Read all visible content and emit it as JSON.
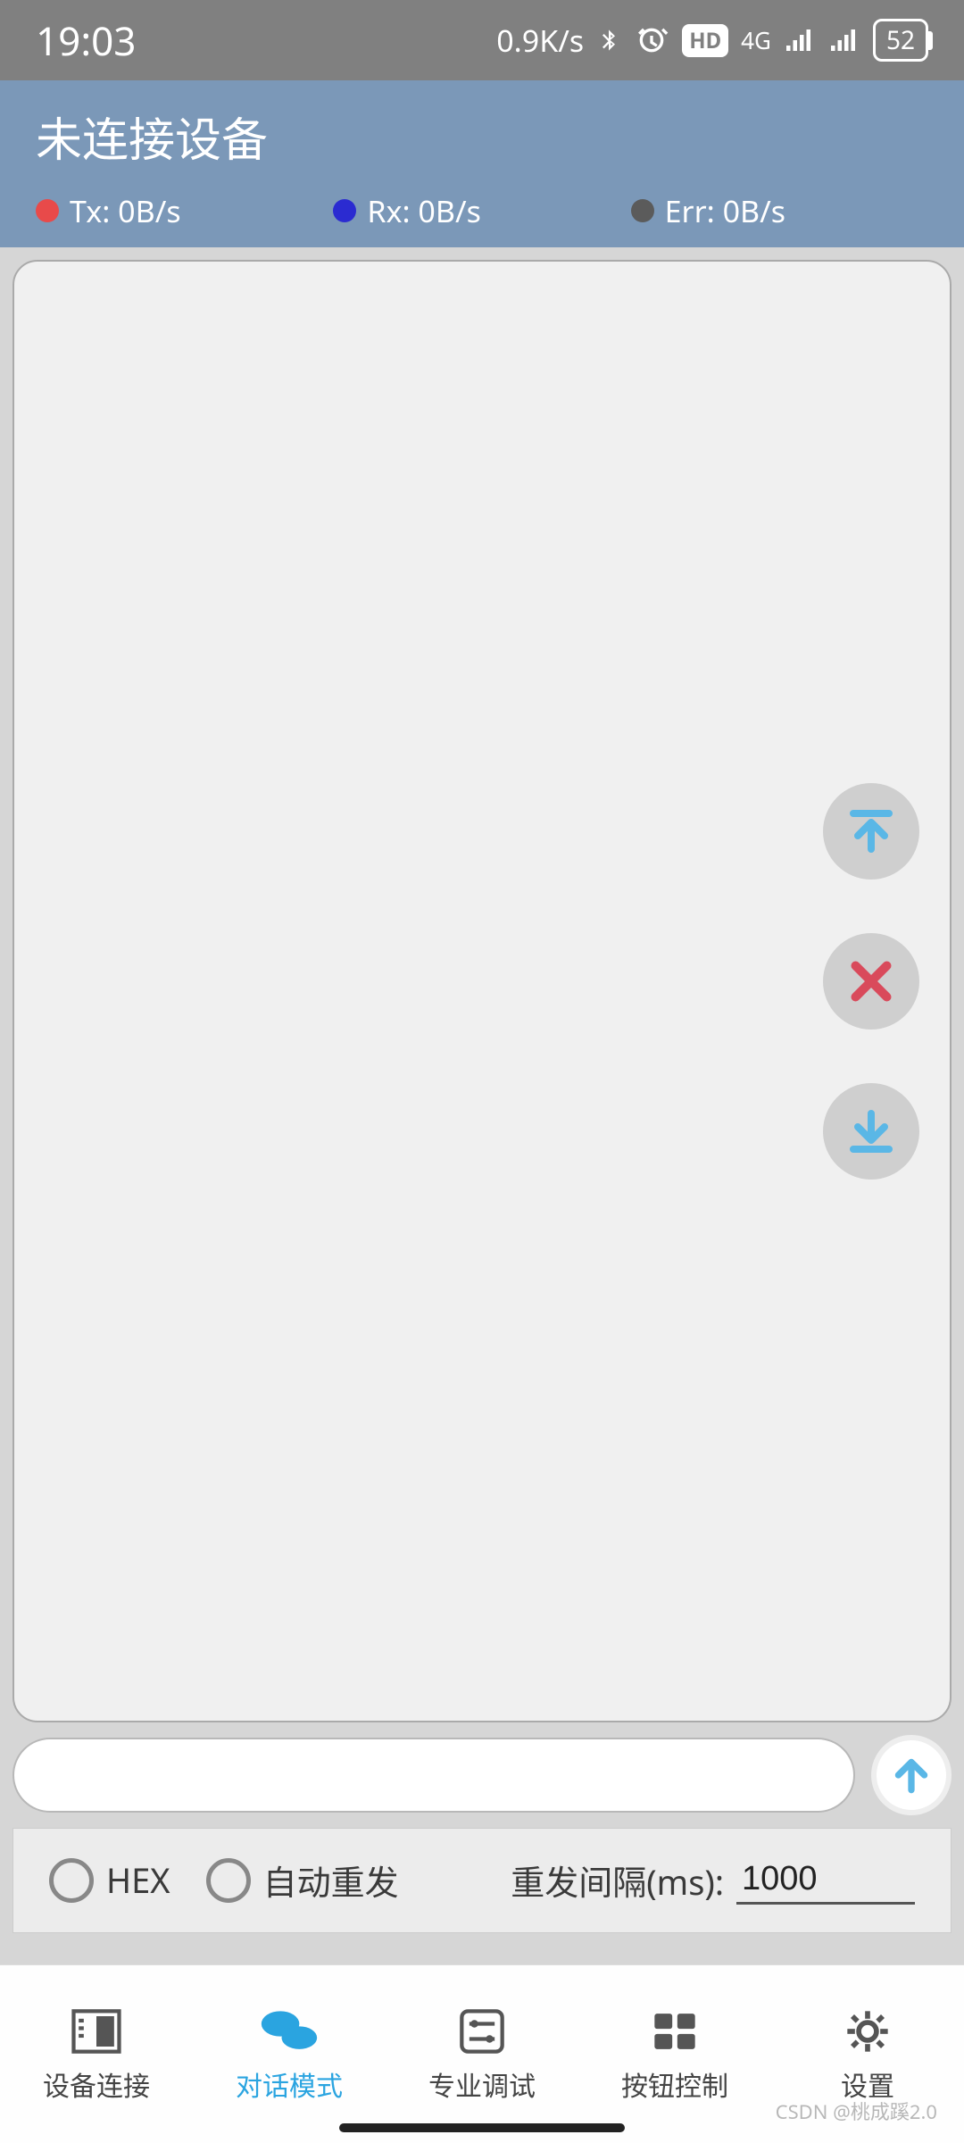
{
  "status": {
    "time": "19:03",
    "net_speed": "0.9K/s",
    "hd": "HD",
    "net_type": "4G",
    "battery": "52"
  },
  "header": {
    "title": "未连接设备",
    "tx": "Tx: 0B/s",
    "rx": "Rx: 0B/s",
    "err": "Err: 0B/s"
  },
  "input": {
    "value": ""
  },
  "options": {
    "hex_label": "HEX",
    "auto_resend_label": "自动重发",
    "interval_label": "重发间隔(ms):",
    "interval_value": "1000"
  },
  "nav": {
    "items": [
      {
        "label": "设备连接"
      },
      {
        "label": "对话模式"
      },
      {
        "label": "专业调试"
      },
      {
        "label": "按钮控制"
      },
      {
        "label": "设置"
      }
    ],
    "active_index": 1
  },
  "watermark": "CSDN @桃成蹊2.0"
}
